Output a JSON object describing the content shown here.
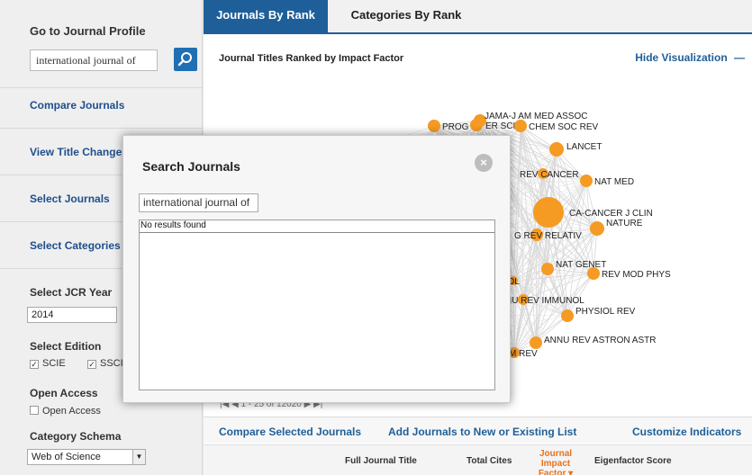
{
  "sidebar": {
    "goto_label": "Go to Journal Profile",
    "search_value": "international journal of",
    "compare_label": "Compare Journals",
    "title_changes_label": "View Title Changes",
    "select_journals_label": "Select Journals",
    "select_categories_label": "Select Categories",
    "jcr_year_label": "Select JCR Year",
    "jcr_year_value": "2014",
    "edition_label": "Select Edition",
    "edition_options": [
      "SCIE",
      "SSCI"
    ],
    "open_access_label": "Open Access",
    "open_access_option": "Open Access",
    "category_schema_label": "Category Schema",
    "category_schema_value": "Web of Science"
  },
  "main": {
    "tabs": [
      {
        "label": "Journals By Rank",
        "active": true
      },
      {
        "label": "Categories By Rank",
        "active": false
      }
    ],
    "panel_title": "Journal Titles Ranked by Impact Factor",
    "hide_visualization": "Hide Visualization",
    "pager": "1 - 25 of 12020",
    "links": {
      "compare": "Compare Selected Journals",
      "add_list": "Add Journals to New or Existing List",
      "customize": "Customize Indicators"
    },
    "columns": {
      "full_title": "Full Journal Title",
      "total_cites": "Total Cites",
      "jif": "Journal Impact Factor",
      "eigenfactor": "Eigenfactor Score"
    }
  },
  "network": {
    "node_color": "#f59a23",
    "nodes": [
      {
        "label": "JAMA-J AM MED ASSOC"
      },
      {
        "label": "PROG M"
      },
      {
        "label": "ER SCI"
      },
      {
        "label": "CHEM SOC REV"
      },
      {
        "label": "LANCET"
      },
      {
        "label": "REV CANCER"
      },
      {
        "label": "NAT MED"
      },
      {
        "label": "CA-CANCER J CLIN"
      },
      {
        "label": "NATURE"
      },
      {
        "label": "G REV RELATIV"
      },
      {
        "label": "NAT GENET"
      },
      {
        "label": "REV MOD PHYS"
      },
      {
        "label": "HNOL"
      },
      {
        "label": "NU REV IMMUNOL"
      },
      {
        "label": "PHYSIOL REV"
      },
      {
        "label": "ANNU REV ASTRON ASTR"
      },
      {
        "label": "M REV"
      }
    ]
  },
  "modal": {
    "title": "Search Journals",
    "input_value": "international journal of",
    "results_message": "No results found",
    "close_symbol": "×"
  }
}
